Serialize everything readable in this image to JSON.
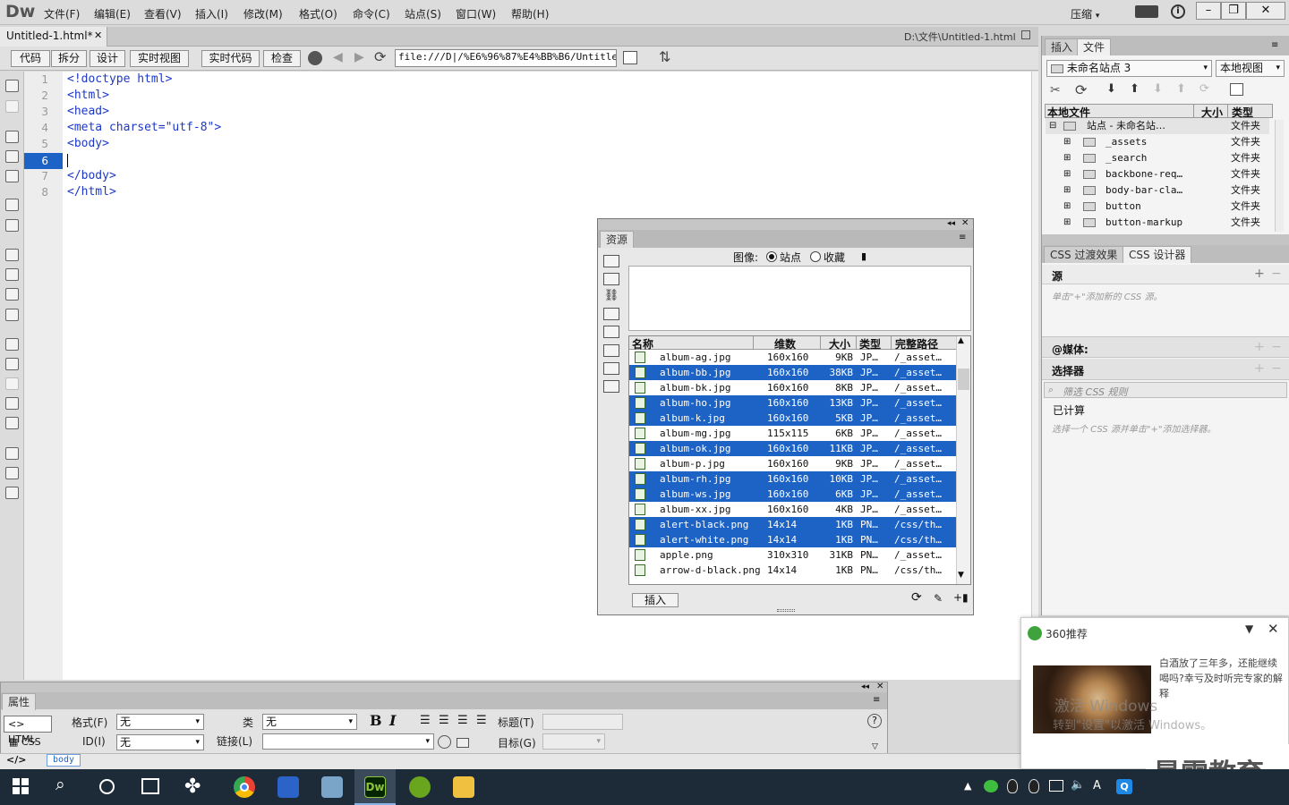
{
  "app": {
    "logo": "Dw"
  },
  "menu": [
    "文件(F)",
    "编辑(E)",
    "查看(V)",
    "插入(I)",
    "修改(M)",
    "格式(O)",
    "命令(C)",
    "站点(S)",
    "窗口(W)",
    "帮助(H)"
  ],
  "workspace": {
    "label": "压缩"
  },
  "document": {
    "tab": "Untitled-1.html*",
    "path": "D:\\文件\\Untitled-1.html"
  },
  "toolbar": {
    "code": "代码",
    "split": "拆分",
    "design": "设计",
    "live": "实时视图",
    "live_code": "实时代码",
    "inspect": "检查",
    "address": "file:///D|/%E6%96%87%E4%BB%B6/Untitled"
  },
  "code": {
    "lines": [
      {
        "n": "1",
        "text": "<!doctype html>"
      },
      {
        "n": "2",
        "text": "<html>"
      },
      {
        "n": "3",
        "text": "<head>"
      },
      {
        "n": "4",
        "text": "<meta charset=\"utf-8\">"
      },
      {
        "n": "5",
        "text": "<body>"
      },
      {
        "n": "6",
        "text": ""
      },
      {
        "n": "7",
        "text": "</body>"
      },
      {
        "n": "8",
        "text": "</html>"
      }
    ]
  },
  "files_panel": {
    "tabs": [
      "插入",
      "文件"
    ],
    "site": "未命名站点 3",
    "view": "本地视图",
    "headers": [
      "本地文件",
      "大小",
      "类型"
    ],
    "root": {
      "name": "站点 - 未命名站…",
      "type": "文件夹"
    },
    "items": [
      {
        "name": "_assets",
        "type": "文件夹"
      },
      {
        "name": "_search",
        "type": "文件夹"
      },
      {
        "name": "backbone-req…",
        "type": "文件夹"
      },
      {
        "name": "body-bar-cla…",
        "type": "文件夹"
      },
      {
        "name": "button",
        "type": "文件夹"
      },
      {
        "name": "button-markup",
        "type": "文件夹"
      }
    ]
  },
  "css_panel": {
    "tabs": [
      "CSS 过渡效果",
      "CSS 设计器"
    ],
    "sources": "源",
    "sources_hint": "单击\"+\"添加新的 CSS 源。",
    "media": "@媒体:",
    "selectors": "选择器",
    "filter": "筛选 CSS 规则",
    "computed": "已计算",
    "computed_hint": "选择一个 CSS 源并单击\"+\"添加选择器。"
  },
  "assets_panel": {
    "title": "资源",
    "image_label": "图像:",
    "site": "站点",
    "favorites": "收藏",
    "headers": [
      "名称",
      "维数",
      "大小",
      "类型",
      "完整路径"
    ],
    "rows": [
      {
        "name": "album-ag.jpg",
        "dim": "160x160",
        "size": "9KB",
        "type": "JP…",
        "path": "/_asset…",
        "selected": false
      },
      {
        "name": "album-bb.jpg",
        "dim": "160x160",
        "size": "38KB",
        "type": "JP…",
        "path": "/_asset…",
        "selected": true
      },
      {
        "name": "album-bk.jpg",
        "dim": "160x160",
        "size": "8KB",
        "type": "JP…",
        "path": "/_asset…",
        "selected": false
      },
      {
        "name": "album-ho.jpg",
        "dim": "160x160",
        "size": "13KB",
        "type": "JP…",
        "path": "/_asset…",
        "selected": true
      },
      {
        "name": "album-k.jpg",
        "dim": "160x160",
        "size": "5KB",
        "type": "JP…",
        "path": "/_asset…",
        "selected": true
      },
      {
        "name": "album-mg.jpg",
        "dim": "115x115",
        "size": "6KB",
        "type": "JP…",
        "path": "/_asset…",
        "selected": false
      },
      {
        "name": "album-ok.jpg",
        "dim": "160x160",
        "size": "11KB",
        "type": "JP…",
        "path": "/_asset…",
        "selected": true
      },
      {
        "name": "album-p.jpg",
        "dim": "160x160",
        "size": "9KB",
        "type": "JP…",
        "path": "/_asset…",
        "selected": false
      },
      {
        "name": "album-rh.jpg",
        "dim": "160x160",
        "size": "10KB",
        "type": "JP…",
        "path": "/_asset…",
        "selected": true
      },
      {
        "name": "album-ws.jpg",
        "dim": "160x160",
        "size": "6KB",
        "type": "JP…",
        "path": "/_asset…",
        "selected": true
      },
      {
        "name": "album-xx.jpg",
        "dim": "160x160",
        "size": "4KB",
        "type": "JP…",
        "path": "/_asset…",
        "selected": false
      },
      {
        "name": "alert-black.png",
        "dim": "14x14",
        "size": "1KB",
        "type": "PN…",
        "path": "/css/th…",
        "selected": true
      },
      {
        "name": "alert-white.png",
        "dim": "14x14",
        "size": "1KB",
        "type": "PN…",
        "path": "/css/th…",
        "selected": true
      },
      {
        "name": "apple.png",
        "dim": "310x310",
        "size": "31KB",
        "type": "PN…",
        "path": "/_asset…",
        "selected": false
      },
      {
        "name": "arrow-d-black.png",
        "dim": "14x14",
        "size": "1KB",
        "type": "PN…",
        "path": "/css/th…",
        "selected": false
      }
    ],
    "insert": "插入"
  },
  "properties": {
    "title": "属性",
    "html": "HTML",
    "css": "CSS",
    "format_label": "格式(F)",
    "format_value": "无",
    "class_label": "类",
    "class_value": "无",
    "id_label": "ID(I)",
    "id_value": "无",
    "link_label": "链接(L)",
    "title_label": "标题(T)",
    "target_label": "目标(G)",
    "bold": "B",
    "italic": "I"
  },
  "statusbar": {
    "tag": "body"
  },
  "popup": {
    "title": "360推荐",
    "text": "白酒放了三年多，还能继续喝吗?幸亏及时听完专家的解释",
    "watermark1": "激活 Windows",
    "watermark2": "转到\"设置\"以激活 Windows。"
  },
  "brand_watermark": "最需教育",
  "colors": {
    "selection": "#1d63c6",
    "code_blue": "#1d38c7",
    "taskbar": "#1d2a38"
  }
}
